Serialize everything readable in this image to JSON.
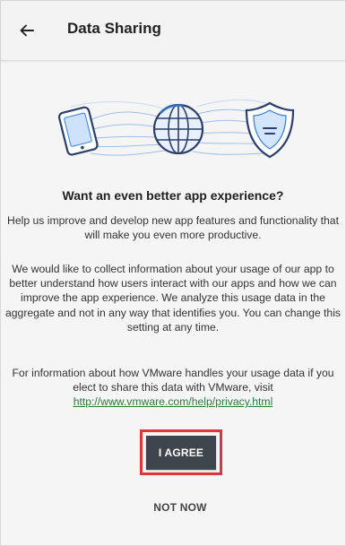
{
  "header": {
    "back_icon": "arrow-left-icon",
    "title": "Data Sharing"
  },
  "hero": {
    "icons": [
      "tablet-device-icon",
      "globe-icon",
      "shield-icon"
    ],
    "accent_color": "#2f7fd6"
  },
  "content": {
    "headline": "Want an even better app experience?",
    "paragraph1": "Help us improve and develop new app features and functionality that will make you even more productive.",
    "paragraph2": "We would like to collect information about your usage of our app to better understand how users interact with our apps and how we can improve the app experience. We analyze this usage data in the aggregate and not in any way that identifies you. You can change this setting at any time.",
    "paragraph3": "For information about how VMware handles your usage data if you elect to share this data with VMware, visit",
    "privacy_link": "http://www.vmware.com/help/privacy.html"
  },
  "actions": {
    "agree_label": "I AGREE",
    "not_now_label": "NOT NOW",
    "agree_highlight_color": "#e0353d"
  }
}
